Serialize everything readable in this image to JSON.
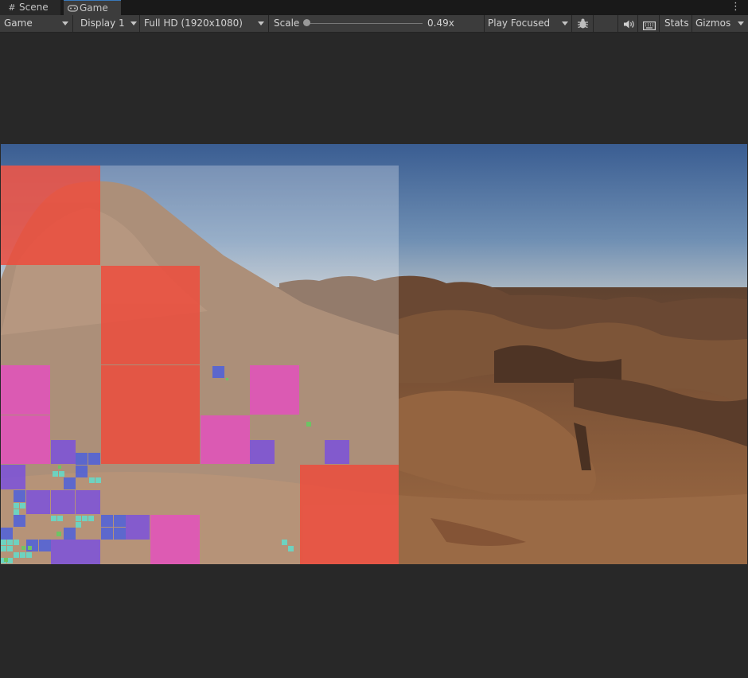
{
  "tabs": [
    {
      "label": "Scene",
      "icon": "grid-icon",
      "active": false
    },
    {
      "label": "Game",
      "icon": "gamepad-icon",
      "active": true
    }
  ],
  "toolbar": {
    "mode_select": "Game",
    "display_select": "Display 1",
    "resolution_select": "Full HD (1920x1080)",
    "scale_label": "Scale",
    "scale_value": "0.49x",
    "scale_fraction": 0.0,
    "play_mode_select": "Play Focused",
    "stats_label": "Stats",
    "gizmos_label": "Gizmos"
  },
  "icons": {
    "more": "kebab-menu-icon",
    "bug": "bug-icon",
    "audio": "speaker-icon",
    "keyboard": "keyboard-icon"
  },
  "colors": {
    "tab_active_accent": "#3a79bb",
    "toolbar_bg": "#3c3c3c",
    "panel_bg": "#282828",
    "overlay_red": "#f04a3a",
    "overlay_pink": "#e64fc0",
    "overlay_purple": "#7a4fe0",
    "overlay_blue": "#4a5fe0",
    "overlay_cyan": "#5fe0d0",
    "overlay_green": "#5fd060"
  }
}
